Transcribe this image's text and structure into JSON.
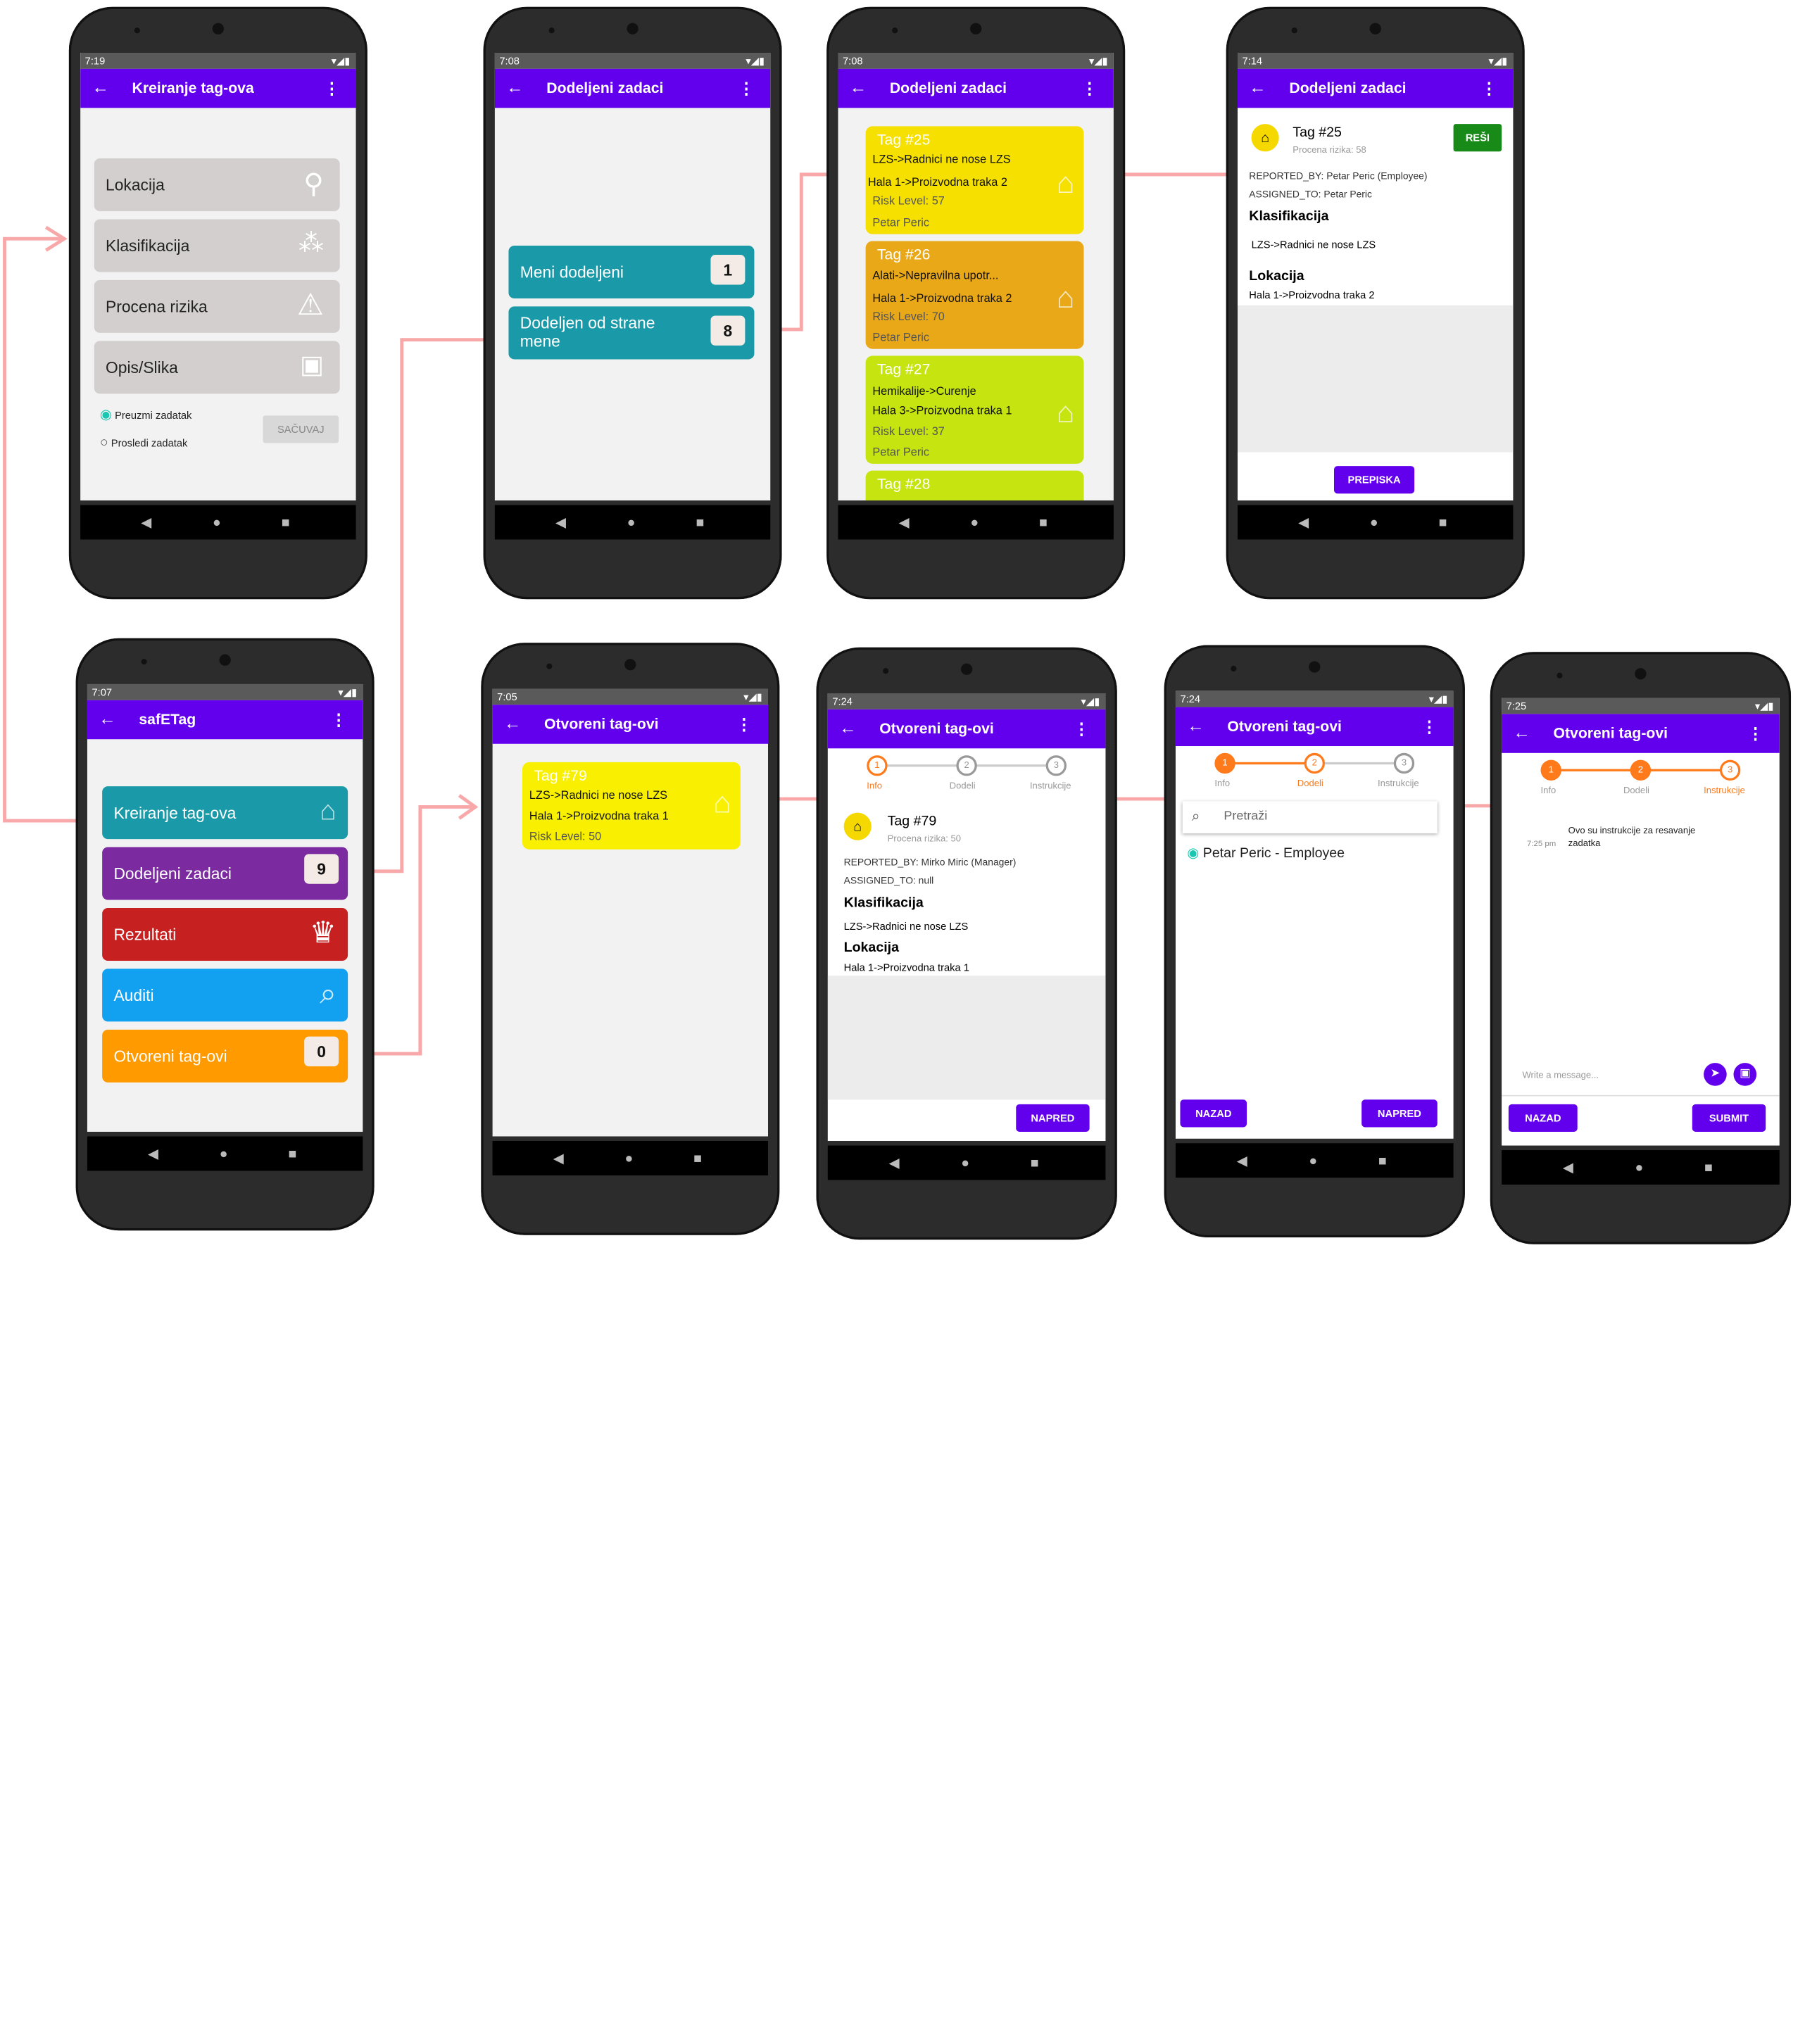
{
  "colors": {
    "appbar": "#6200ee",
    "accent": "#ff7a1a",
    "connector": "#f8a8a8"
  },
  "screens": {
    "kreiranje": {
      "time": "7:19",
      "title": "Kreiranje tag-ova",
      "items": [
        "Lokacija",
        "Klasifikacija",
        "Procena rizika",
        "Opis/Slika"
      ],
      "item_icons": [
        "location-pin-icon",
        "hierarchy-icon",
        "warning-icon",
        "image-message-icon"
      ],
      "radio1": "Preuzmi zadatak",
      "radio2": "Prosledi zadatak",
      "save": "SAČUVAJ"
    },
    "dodeljeni_meni": {
      "time": "7:08",
      "title": "Dodeljeni zadaci",
      "meni": "Meni dodeljeni",
      "meni_count": "1",
      "od_strane": "Dodeljen od strane mene",
      "od_strane_count": "8"
    },
    "dodeljeni_lista": {
      "time": "7:08",
      "title": "Dodeljeni zadaci",
      "tags": [
        {
          "name": "Tag #25",
          "line1": "LZS->Radnici ne nose LZS",
          "line2": "Hala 1->Proizvodna traka 2",
          "risk": "Risk Level: 57",
          "person": "Petar Peric",
          "color": "#f5e000"
        },
        {
          "name": "Tag #26",
          "line1": "Alati->Nepravilna upotr...",
          "line2": "Hala 1->Proizvodna traka 2",
          "risk": "Risk Level: 70",
          "person": "Petar Peric",
          "color": "#e8a818"
        },
        {
          "name": "Tag #27",
          "line1": "Hemikalije->Curenje",
          "line2": "Hala 3->Proizvodna traka 1",
          "risk": "Risk Level: 37",
          "person": "Petar Peric",
          "color": "#c5e410"
        },
        {
          "name": "Tag #28",
          "color": "#c5e410"
        }
      ]
    },
    "detalj25": {
      "time": "7:14",
      "title": "Dodeljeni zadaci",
      "tag": "Tag #25",
      "procena": "Procena rizika: 58",
      "resi": "REŠI",
      "reported": "REPORTED_BY: Petar Peric (Employee)",
      "assigned": "ASSIGNED_TO: Petar Peric",
      "klas_h": "Klasifikacija",
      "klas": "LZS->Radnici ne nose LZS",
      "lok_h": "Lokacija",
      "lok": "Hala 1->Proizvodna traka 2",
      "prepiska": "PREPISKA"
    },
    "safetag": {
      "time": "7:07",
      "title": "safETag",
      "items": [
        {
          "label": "Kreiranje tag-ova",
          "color": "#1a9aa8"
        },
        {
          "label": "Dodeljeni zadaci",
          "color": "#7b2aa0",
          "badge": "9"
        },
        {
          "label": "Rezultati",
          "color": "#c62020"
        },
        {
          "label": "Auditi",
          "color": "#12a0f0"
        },
        {
          "label": "Otvoreni tag-ovi",
          "color": "#ff9a00",
          "badge": "0"
        }
      ]
    },
    "otvoreni_lista": {
      "time": "7:05",
      "title": "Otvoreni tag-ovi",
      "tag": {
        "name": "Tag #79",
        "line1": "LZS->Radnici ne nose LZS",
        "line2": "Hala 1->Proizvodna traka 1",
        "risk": "Risk Level: 50"
      }
    },
    "otvoreni_info": {
      "time": "7:24",
      "title": "Otvoreni tag-ovi",
      "steps": [
        "Info",
        "Dodeli",
        "Instrukcije"
      ],
      "tag": "Tag #79",
      "procena": "Procena rizika: 50",
      "reported": "REPORTED_BY: Mirko Miric (Manager)",
      "assigned": "ASSIGNED_TO: null",
      "klas_h": "Klasifikacija",
      "klas": "LZS->Radnici ne nose LZS",
      "lok_h": "Lokacija",
      "lok": "Hala 1->Proizvodna traka 1",
      "napred": "NAPRED"
    },
    "otvoreni_dodeli": {
      "time": "7:24",
      "title": "Otvoreni tag-ovi",
      "steps": [
        "Info",
        "Dodeli",
        "Instrukcije"
      ],
      "search": "Pretraži",
      "employee": "Petar Peric - Employee",
      "nazad": "NAZAD",
      "napred": "NAPRED"
    },
    "otvoreni_instr": {
      "time": "7:25",
      "title": "Otvoreni tag-ovi",
      "steps": [
        "Info",
        "Dodeli",
        "Instrukcije"
      ],
      "msg_time": "7:25 pm",
      "message": "Ovo su instrukcije za resavanje zadatka",
      "placeholder": "Write a message...",
      "nazad": "NAZAD",
      "submit": "SUBMIT"
    }
  }
}
